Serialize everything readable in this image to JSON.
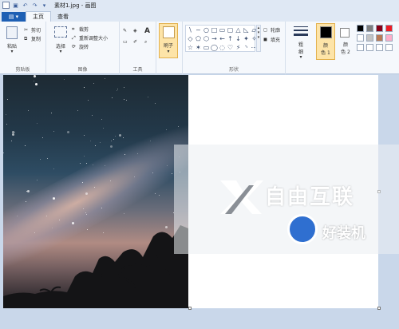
{
  "window": {
    "title": "素材1.jpg - 画图"
  },
  "quick_access": [
    "save-icon",
    "undo-icon",
    "redo-icon",
    "customize-icon"
  ],
  "tabs": {
    "file_label": "",
    "home": "主页",
    "view": "查看"
  },
  "clipboard": {
    "paste": "粘贴",
    "cut": "剪切",
    "copy": "复制",
    "label": "剪贴板"
  },
  "image": {
    "select": "选择",
    "crop": "裁剪",
    "resize": "重新调整大小",
    "rotate": "旋转",
    "label": "图像"
  },
  "tools": {
    "label": "工具",
    "text_tool": "A"
  },
  "brushes": {
    "label": "刷子"
  },
  "shapes": {
    "label": "形状",
    "outline": "轮廓",
    "fill": "填充",
    "glyphs": [
      "\\",
      "~",
      "○",
      "□",
      "▭",
      "▢",
      "△",
      "◺",
      "▱",
      "◇",
      "⬠",
      "⬡",
      "→",
      "←",
      "↑",
      "↓",
      "✦",
      "✧",
      "☆",
      "✶",
      "▭",
      "◯",
      "◌",
      "♡",
      "⚡",
      "◝",
      "⋯"
    ]
  },
  "size": {
    "label1": "粗",
    "label2": "细"
  },
  "colors": {
    "color1_label": "颜",
    "color1_sub": "色 1",
    "color2_label": "颜",
    "color2_sub": "色 2",
    "color1": "#000000",
    "color2": "#ffffff",
    "palette": [
      "#000000",
      "#7f7f7f",
      "#880015",
      "#ed1c24",
      "#ffffff",
      "#c3c3c3",
      "#b97a57",
      "#ffaec9",
      "#ffffff",
      "#ffffff",
      "#ffffff",
      "#ffffff"
    ]
  },
  "watermark": {
    "brand1": "自由互联",
    "brand2": "好装机"
  }
}
